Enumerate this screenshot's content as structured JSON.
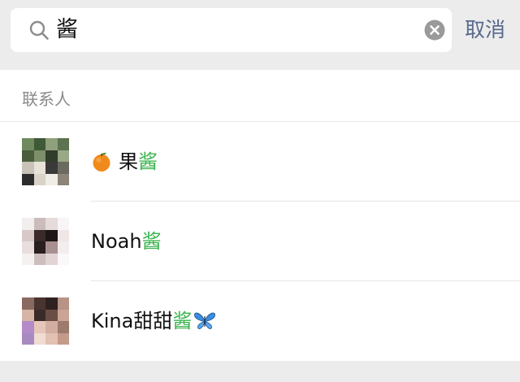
{
  "search": {
    "query": "酱",
    "cancel_label": "取消"
  },
  "section": {
    "title": "联系人"
  },
  "contacts": [
    {
      "name_prefix": "果",
      "name_match": "酱",
      "name_suffix": "",
      "leading_icon": "orange-emoji",
      "trailing_icon": ""
    },
    {
      "name_prefix": "Noah",
      "name_match": "酱",
      "name_suffix": "",
      "leading_icon": "",
      "trailing_icon": ""
    },
    {
      "name_prefix": "Kina甜甜",
      "name_match": "酱",
      "name_suffix": "",
      "leading_icon": "",
      "trailing_icon": "butterfly-emoji"
    }
  ],
  "colors": {
    "highlight": "#3bb34d",
    "cancel": "#57698c",
    "background": "#ececec"
  }
}
